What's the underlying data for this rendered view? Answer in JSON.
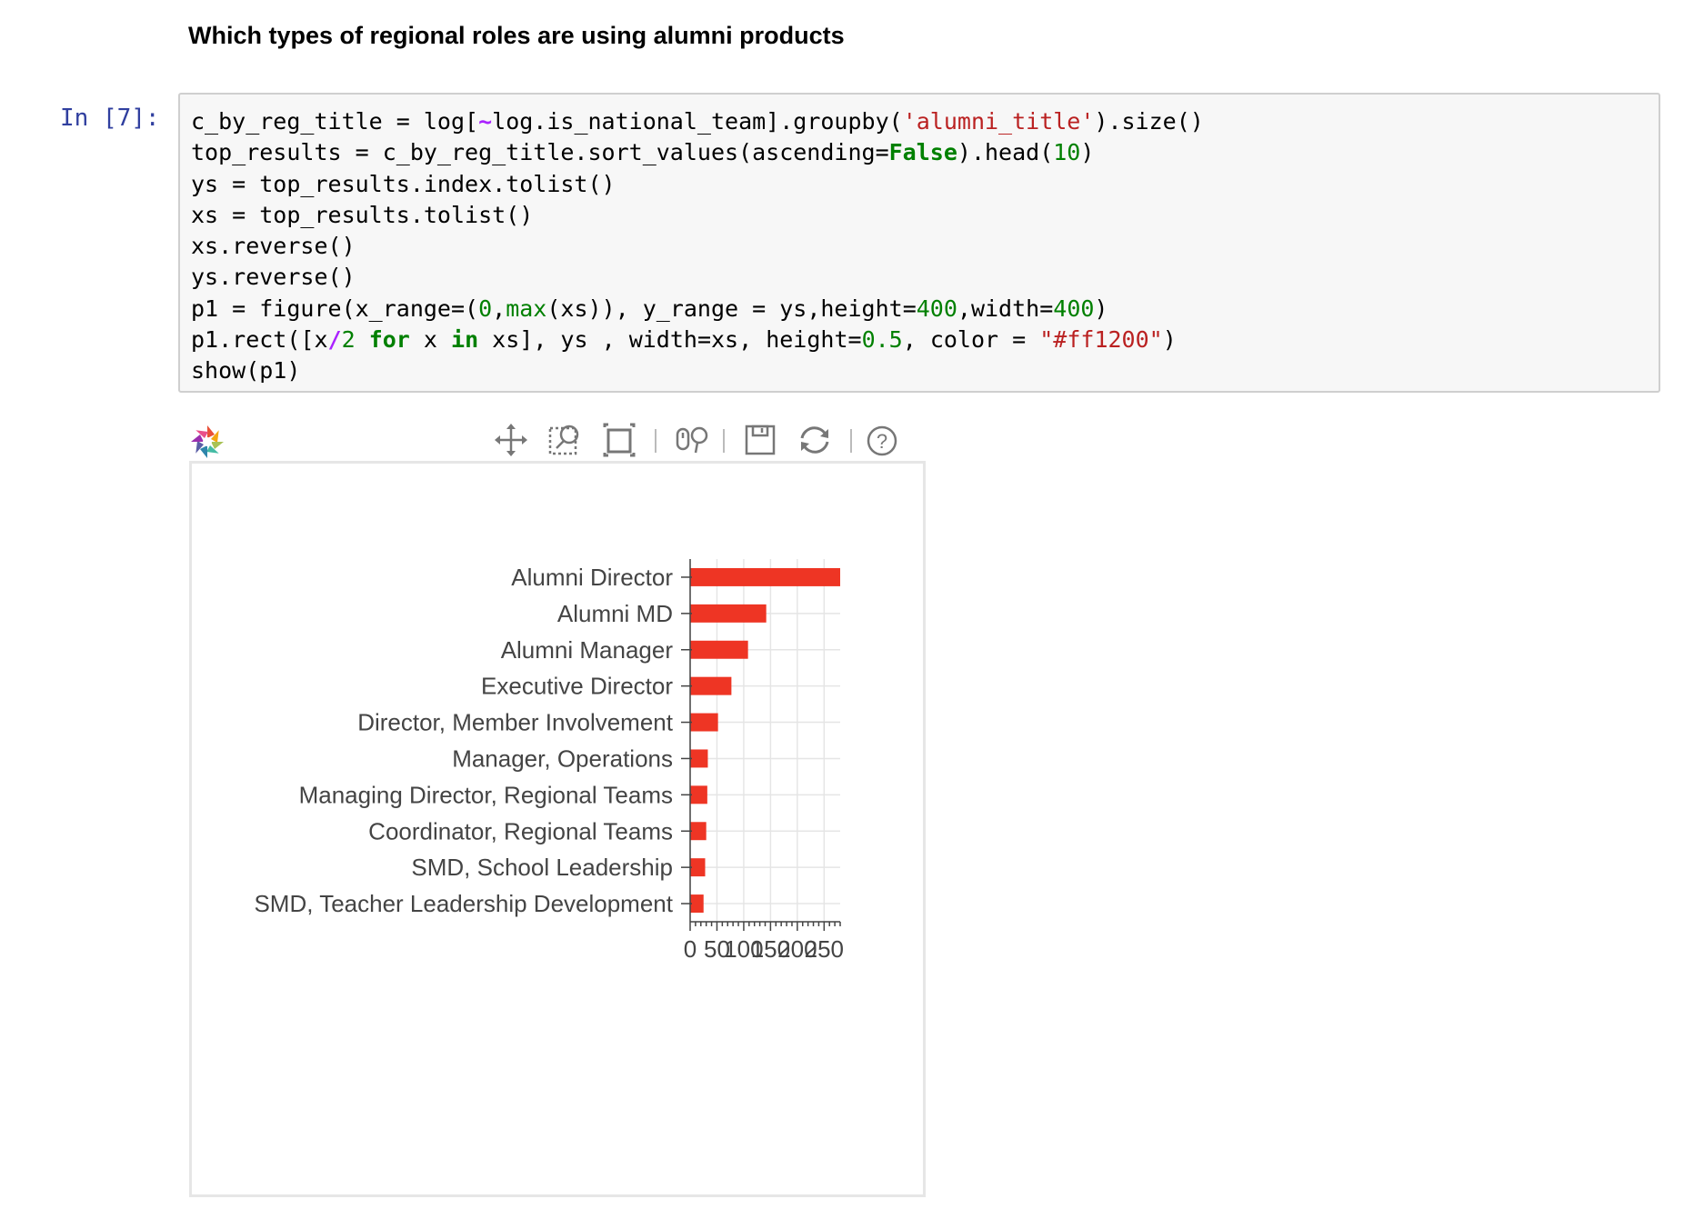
{
  "heading": "Which types of regional roles are using alumni products",
  "cell": {
    "prompt": "In [7]:",
    "lines": [
      [
        {
          "t": "c_by_reg_title = log["
        },
        {
          "t": "~",
          "c": "op"
        },
        {
          "t": "log.is_national_team].groupby("
        },
        {
          "t": "'alumni_title'",
          "c": "str"
        },
        {
          "t": ").size()"
        }
      ],
      [
        {
          "t": "top_results = c_by_reg_title.sort_values(ascending="
        },
        {
          "t": "False",
          "c": "kw"
        },
        {
          "t": ").head("
        },
        {
          "t": "10",
          "c": "num"
        },
        {
          "t": ")"
        }
      ],
      [
        {
          "t": "ys = top_results.index.tolist()"
        }
      ],
      [
        {
          "t": "xs = top_results.tolist()"
        }
      ],
      [
        {
          "t": "xs.reverse()"
        }
      ],
      [
        {
          "t": "ys.reverse()"
        }
      ],
      [
        {
          "t": "p1 = figure(x_range=("
        },
        {
          "t": "0",
          "c": "num"
        },
        {
          "t": ","
        },
        {
          "t": "max",
          "c": "bi"
        },
        {
          "t": "(xs)), y_range = ys,height="
        },
        {
          "t": "400",
          "c": "num"
        },
        {
          "t": ",width="
        },
        {
          "t": "400",
          "c": "num"
        },
        {
          "t": ")"
        }
      ],
      [
        {
          "t": "p1.rect([x"
        },
        {
          "t": "/",
          "c": "op"
        },
        {
          "t": "2",
          "c": "num"
        },
        {
          "t": " "
        },
        {
          "t": "for",
          "c": "kw"
        },
        {
          "t": " x "
        },
        {
          "t": "in",
          "c": "kw"
        },
        {
          "t": " xs], ys , width=xs, height="
        },
        {
          "t": "0.5",
          "c": "num"
        },
        {
          "t": ", color = "
        },
        {
          "t": "\"#ff1200\"",
          "c": "str"
        },
        {
          "t": ")"
        }
      ],
      [
        {
          "t": "show(p1)"
        }
      ]
    ]
  },
  "toolbar": {
    "tools": [
      "pan-icon",
      "box-zoom-icon",
      "reset-frame-icon",
      "wheel-zoom-icon",
      "save-icon",
      "reset-icon",
      "help-icon"
    ],
    "accent": "#26aae1"
  },
  "chart_data": {
    "type": "bar",
    "orientation": "horizontal",
    "bar_color": "#ee3524",
    "categories": [
      "Alumni Director",
      "Alumni MD",
      "Alumni Manager",
      "Executive Director",
      "Director, Member Involvement",
      "Manager, Operations",
      "Managing Director, Regional Teams",
      "Coordinator, Regional Teams",
      "SMD, School Leadership",
      "SMD, Teacher Leadership Development"
    ],
    "values": [
      280,
      142,
      108,
      77,
      52,
      33,
      32,
      30,
      28,
      25
    ],
    "xlim": [
      0,
      280
    ],
    "xticks": [
      0,
      50,
      100,
      150,
      200,
      250
    ],
    "xtick_labels": [
      "0",
      "50",
      "100",
      "150",
      "200",
      "250"
    ],
    "grid": true
  }
}
